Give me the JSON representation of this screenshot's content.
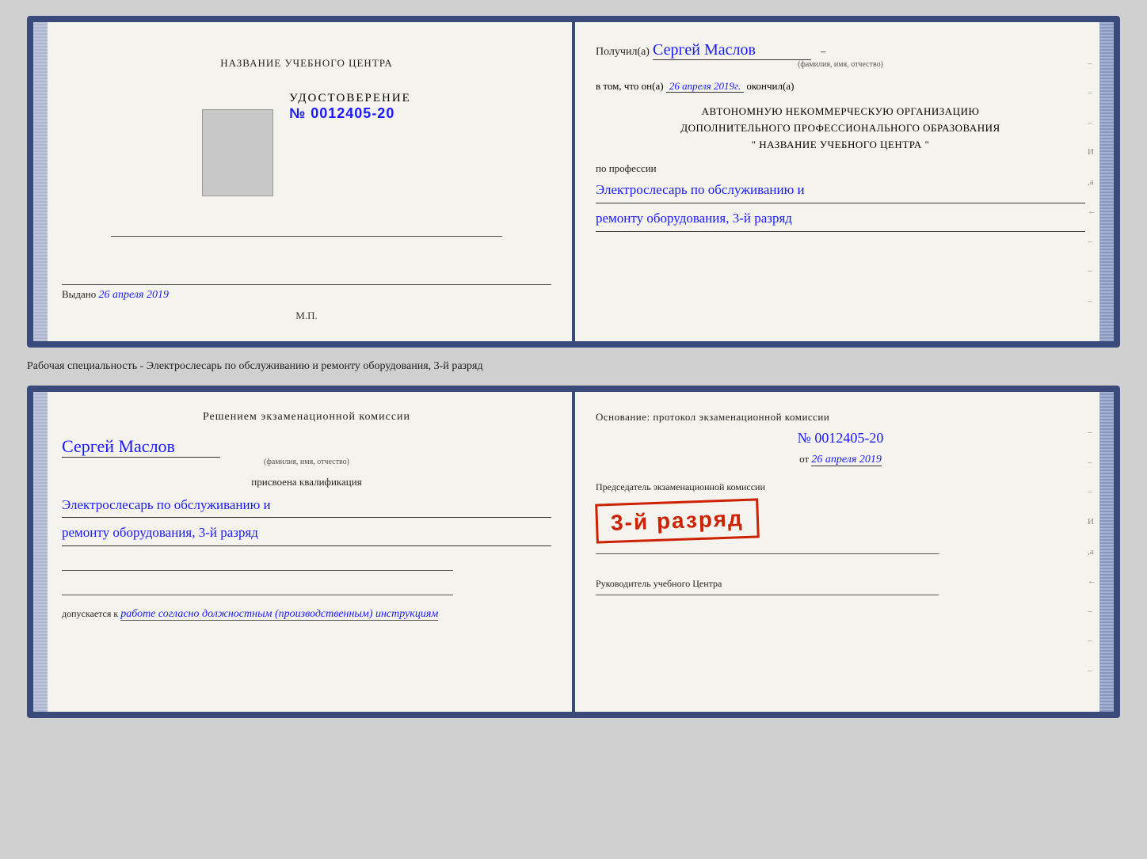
{
  "top_card": {
    "left": {
      "org_name": "НАЗВАНИЕ УЧЕБНОГО ЦЕНТРА",
      "cert_title": "УДОСТОВЕРЕНИЕ",
      "cert_number": "№ 0012405-20",
      "issued_label": "Выдано",
      "issued_date": "26 апреля 2019",
      "mp_label": "М.П."
    },
    "right": {
      "received_prefix": "Получил(а)",
      "recipient_name": "Сергей Маслов",
      "fio_label": "(фамилия, имя, отчество)",
      "in_that_prefix": "в том, что он(а)",
      "date_value": "26 апреля 2019г.",
      "finished_label": "окончил(а)",
      "org_line1": "АВТОНОМНУЮ НЕКОММЕРЧЕСКУЮ ОРГАНИЗАЦИЮ",
      "org_line2": "ДОПОЛНИТЕЛЬНОГО ПРОФЕССИОНАЛЬНОГО ОБРАЗОВАНИЯ",
      "org_line3": "\"  НАЗВАНИЕ УЧЕБНОГО ЦЕНТРА  \"",
      "profession_label": "по профессии",
      "profession_line1": "Электрослесарь по обслуживанию и",
      "profession_line2": "ремонту оборудования, 3-й разряд"
    }
  },
  "between_text": "Рабочая специальность - Электрослесарь по обслуживанию и ремонту оборудования, 3-й разряд",
  "bottom_card": {
    "left": {
      "resolution_title": "Решением экзаменационной комиссии",
      "recipient_name": "Сергей Маслов",
      "fio_label": "(фамилия, имя, отчество)",
      "qualification_label": "присвоена квалификация",
      "qualification_line1": "Электрослесарь по обслуживанию и",
      "qualification_line2": "ремонту оборудования, 3-й разряд",
      "admitted_prefix": "допускается к",
      "admitted_italic": "работе согласно должностным (производственным) инструкциям"
    },
    "right": {
      "basis_label": "Основание: протокол экзаменационной комиссии",
      "protocol_number": "№  0012405-20",
      "date_prefix": "от",
      "date_value": "26 апреля 2019",
      "stamp_text": "3-й разряд",
      "chairman_label": "Председатель экзаменационной комиссии",
      "head_label": "Руководитель учебного Центра"
    }
  },
  "side_lines": [
    "-",
    "-",
    "-",
    "И",
    ",а",
    "←",
    "-",
    "-",
    "-"
  ],
  "right_dashes": [
    "-",
    "-",
    "-",
    "И",
    ",а",
    "←",
    "-",
    "-",
    "-"
  ]
}
